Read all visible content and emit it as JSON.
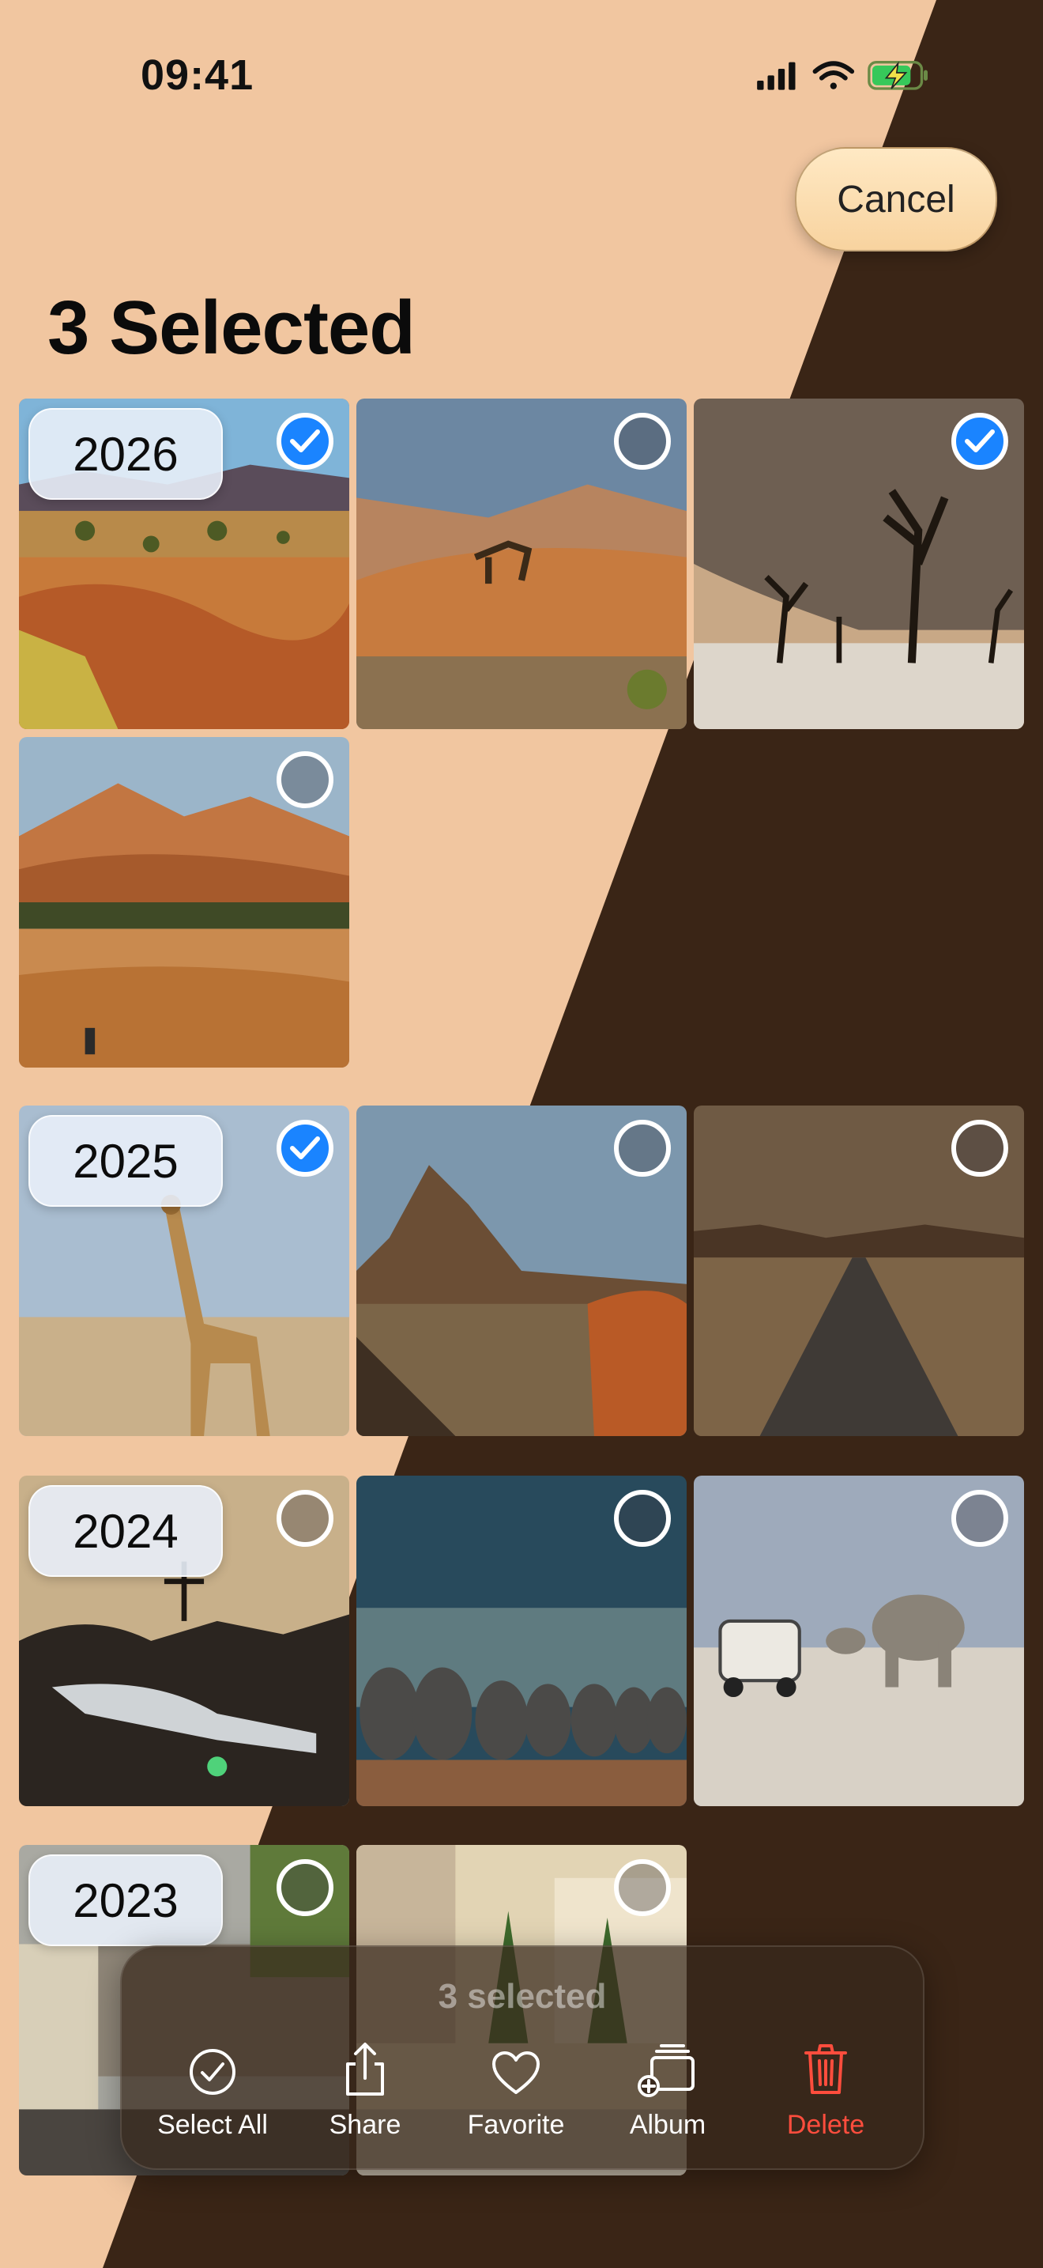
{
  "status_bar": {
    "time": "09:41"
  },
  "header": {
    "cancel_label": "Cancel",
    "title": "3 Selected"
  },
  "sections": [
    {
      "year": "2026",
      "photos": [
        {
          "scene": "desert plain with shrubs",
          "selected": true
        },
        {
          "scene": "springbok on dunes",
          "selected": false
        },
        {
          "scene": "dead trees in dunes",
          "selected": true
        },
        {
          "scene": "red sand dunes",
          "selected": false
        }
      ]
    },
    {
      "year": "2025",
      "photos": [
        {
          "scene": "giraffe",
          "selected": true
        },
        {
          "scene": "rocky mountain",
          "selected": false
        },
        {
          "scene": "gravel road",
          "selected": false
        }
      ]
    },
    {
      "year": "2024",
      "photos": [
        {
          "scene": "rocky sunset",
          "selected": false
        },
        {
          "scene": "elephant herd",
          "selected": false
        },
        {
          "scene": "elephants and jeep",
          "selected": false
        }
      ]
    },
    {
      "year": "2023",
      "photos": [
        {
          "scene": "town street",
          "selected": false
        },
        {
          "scene": "building facade",
          "selected": false
        }
      ]
    }
  ],
  "toolbar": {
    "selected_count": "3 selected",
    "select_all": "Select All",
    "share": "Share",
    "favorite": "Favorite",
    "album": "Album",
    "delete": "Delete"
  },
  "colors": {
    "accent": "#1a84ff",
    "destructive": "#ff4d3d",
    "background_light": "#f1c6a0",
    "background_dark": "#3a2516"
  }
}
